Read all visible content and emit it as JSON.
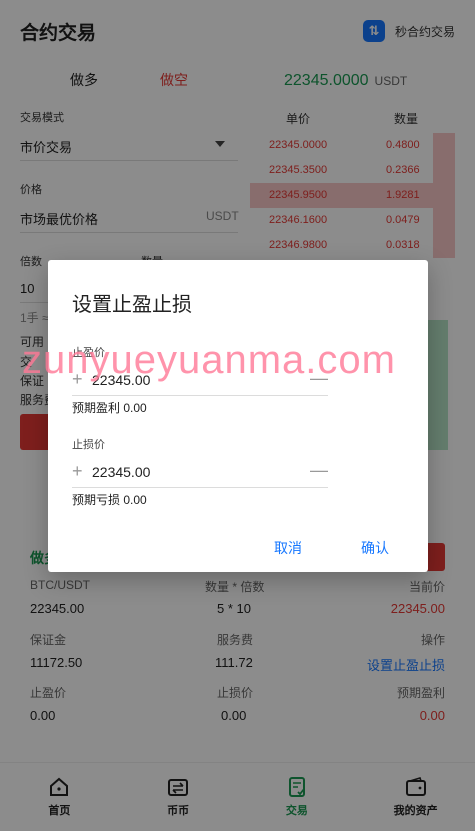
{
  "header": {
    "title": "合约交易",
    "right_label": "秒合约交易"
  },
  "direction": {
    "long": "做多",
    "short": "做空"
  },
  "price": {
    "value": "22345.0000",
    "unit": "USDT"
  },
  "form": {
    "mode_label": "交易模式",
    "mode_value": "市价交易",
    "price_label": "价格",
    "price_value": "市场最优价格",
    "price_unit": "USDT",
    "multiple_label": "倍数",
    "quantity_label": "数量",
    "multiple_value": "10",
    "lot_hint": "1手 ≈",
    "available_label": "可用",
    "fragments": [
      "交",
      "保证",
      "服务费"
    ]
  },
  "orderbook": {
    "header_price": "单价",
    "header_qty": "数量",
    "rows": [
      {
        "price": "22345.0000",
        "qty": "0.4800"
      },
      {
        "price": "22345.3500",
        "qty": "0.2366"
      },
      {
        "price": "22345.9500",
        "qty": "1.9281"
      },
      {
        "price": "22346.1600",
        "qty": "0.0479"
      },
      {
        "price": "22346.9800",
        "qty": "0.0318"
      }
    ]
  },
  "position": {
    "title": "做多",
    "row1": {
      "symbol_label": "BTC/USDT",
      "qty_label": "数量 * 倍数",
      "cur_label": "当前价",
      "symbol_value": "22345.00",
      "qty_value": "5 * 10",
      "cur_value": "22345.00"
    },
    "row2": {
      "margin_label": "保证金",
      "fee_label": "服务费",
      "op_label": "操作",
      "margin_value": "11172.50",
      "fee_value": "111.72",
      "op_value": "设置止盈止损"
    },
    "row3": {
      "tp_label": "止盈价",
      "sl_label": "止损价",
      "pnl_label": "预期盈利",
      "tp_value": "0.00",
      "sl_value": "0.00",
      "pnl_value": "0.00"
    }
  },
  "tabs": [
    {
      "label": "首页",
      "icon": "home-icon"
    },
    {
      "label": "币币",
      "icon": "exchange-icon"
    },
    {
      "label": "交易",
      "icon": "trade-icon"
    },
    {
      "label": "我的资产",
      "icon": "wallet-icon"
    }
  ],
  "dialog": {
    "title": "设置止盈止损",
    "tp_label": "止盈价",
    "tp_value": "22345.00",
    "tp_note_label": "预期盈利",
    "tp_note_value": "0.00",
    "sl_label": "止损价",
    "sl_value": "22345.00",
    "sl_note_label": "预期亏损",
    "sl_note_value": "0.00",
    "cancel": "取消",
    "confirm": "确认"
  },
  "watermark": "zunyueyuanma.com",
  "colors": {
    "up": "#1a9a52",
    "down": "#e53935",
    "link": "#1677ff"
  }
}
